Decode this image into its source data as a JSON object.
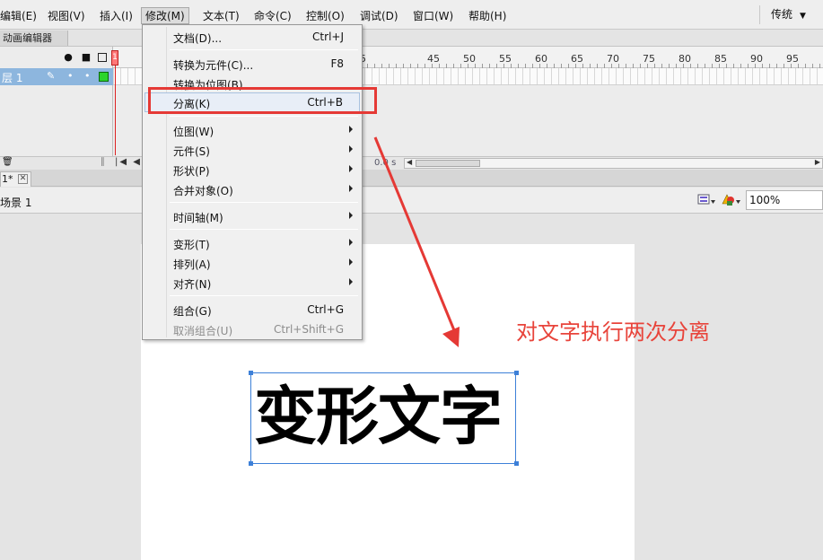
{
  "menubar": {
    "items": [
      "编辑(E)",
      "视图(V)",
      "插入(I)",
      "修改(M)",
      "文本(T)",
      "命令(C)",
      "控制(O)",
      "调试(D)",
      "窗口(W)",
      "帮助(H)"
    ],
    "workspace": "传统"
  },
  "timeline": {
    "tab": "动画编辑器",
    "layer_name": "层 1",
    "ruler": [
      "5",
      "45",
      "50",
      "55",
      "60",
      "65",
      "70",
      "75",
      "80",
      "85",
      "90",
      "95"
    ],
    "current_frame": "1",
    "time": "0.0 s"
  },
  "document": {
    "tab": "1*",
    "scene": "场景 1",
    "zoom": "100%"
  },
  "menu": {
    "items": [
      {
        "label": "文档(D)...",
        "shortcut": "Ctrl+J"
      },
      {
        "label": "转换为元件(C)...",
        "shortcut": "F8"
      },
      {
        "label": "转换为位图(B)",
        "shortcut": ""
      },
      {
        "label": "分离(K)",
        "shortcut": "Ctrl+B"
      },
      {
        "label": "位图(W)",
        "shortcut": ""
      },
      {
        "label": "元件(S)",
        "shortcut": ""
      },
      {
        "label": "形状(P)",
        "shortcut": ""
      },
      {
        "label": "合并对象(O)",
        "shortcut": ""
      },
      {
        "label": "时间轴(M)",
        "shortcut": ""
      },
      {
        "label": "变形(T)",
        "shortcut": ""
      },
      {
        "label": "排列(A)",
        "shortcut": ""
      },
      {
        "label": "对齐(N)",
        "shortcut": ""
      },
      {
        "label": "组合(G)",
        "shortcut": "Ctrl+G"
      },
      {
        "label": "取消组合(U)",
        "shortcut": "Ctrl+Shift+G"
      }
    ]
  },
  "stage": {
    "text": "变形文字"
  },
  "annotation": {
    "text": "对文字执行两次分离",
    "color": "#e53935"
  }
}
